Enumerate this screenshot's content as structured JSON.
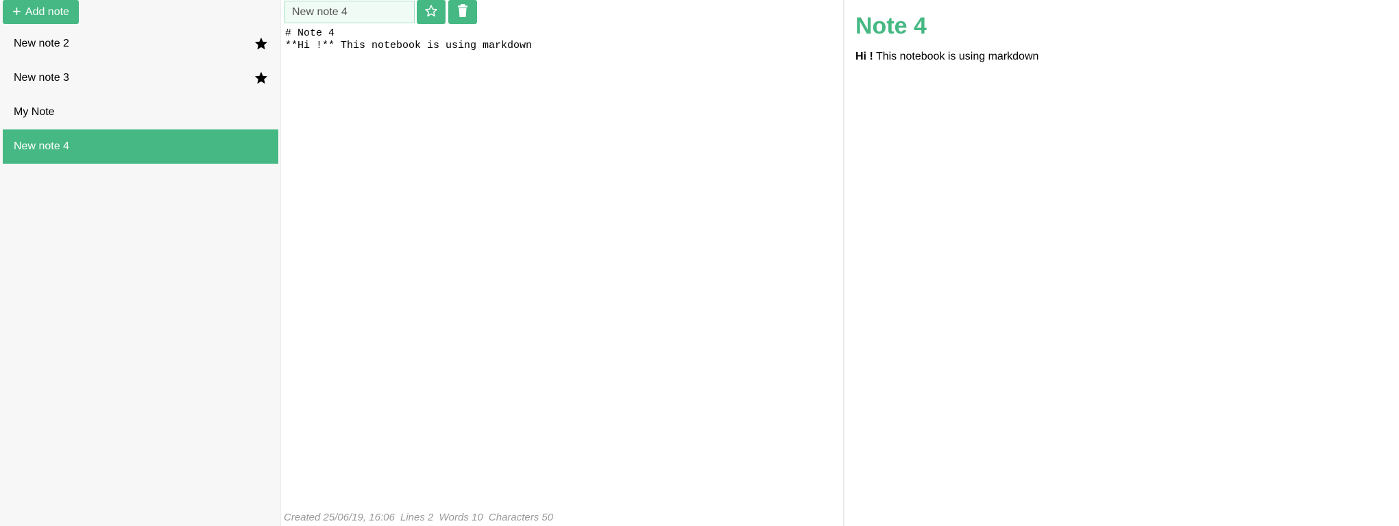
{
  "sidebar": {
    "add_button_label": "Add note",
    "add_icon": "plus-icon",
    "notes": [
      {
        "title": "New note 2",
        "favorite": true
      },
      {
        "title": "New note 3",
        "favorite": true
      },
      {
        "title": "My Note",
        "favorite": false
      },
      {
        "title": "New note 4",
        "favorite": false,
        "active": true
      }
    ]
  },
  "editor": {
    "title_value": "New note 4",
    "favorite_icon": "star-outline-icon",
    "delete_icon": "trash-icon",
    "content": "# Note 4\n**Hi !** This notebook is using markdown"
  },
  "status": {
    "created": "Created 25/06/19, 16:06",
    "lines": "Lines 2",
    "words": "Words 10",
    "characters": "Characters 50"
  },
  "preview": {
    "heading": "Note 4",
    "bold_text": "Hi !",
    "body_text": " This notebook is using markdown"
  },
  "colors": {
    "accent": "#45b883",
    "sidebar_bg": "#f7f7f7",
    "status_text": "#999999"
  }
}
